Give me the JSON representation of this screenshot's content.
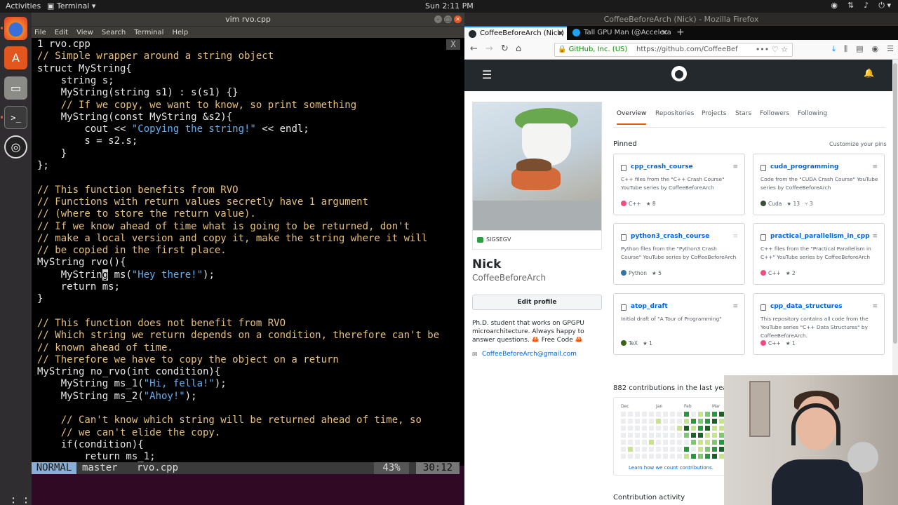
{
  "topbar": {
    "activities": "Activities",
    "app_name": "Terminal",
    "clock": "Sun  2:11 PM"
  },
  "dock": {
    "icons": [
      "firefox-icon",
      "software-icon",
      "files-icon",
      "terminal-icon",
      "obs-icon",
      "show-apps-icon"
    ]
  },
  "terminal": {
    "title": "vim rvo.cpp",
    "menu": [
      "File",
      "Edit",
      "View",
      "Search",
      "Terminal",
      "Help"
    ],
    "tab_close": "X",
    "lines": [
      {
        "ln": "1 ",
        "parts": [
          {
            "t": "rvo.cpp",
            "c": "c-def"
          }
        ]
      },
      {
        "parts": [
          {
            "t": "// Simple wrapper around a string object",
            "c": "c-com"
          }
        ]
      },
      {
        "parts": [
          {
            "t": "struct MyString{",
            "c": "c-def"
          }
        ]
      },
      {
        "parts": [
          {
            "t": "    string s;",
            "c": "c-def"
          }
        ]
      },
      {
        "parts": [
          {
            "t": "    MyString(string s1) : s(s1) {}",
            "c": "c-def"
          }
        ]
      },
      {
        "parts": [
          {
            "t": "    // If we copy, we want to know, so print something",
            "c": "c-com"
          }
        ]
      },
      {
        "parts": [
          {
            "t": "    MyString(const MyString &s2){",
            "c": "c-def"
          }
        ]
      },
      {
        "parts": [
          {
            "t": "        cout << ",
            "c": "c-def"
          },
          {
            "t": "\"Copying the string!\"",
            "c": "c-str"
          },
          {
            "t": " << endl;",
            "c": "c-def"
          }
        ]
      },
      {
        "parts": [
          {
            "t": "        s = s2.s;",
            "c": "c-def"
          }
        ]
      },
      {
        "parts": [
          {
            "t": "    }",
            "c": "c-def"
          }
        ]
      },
      {
        "parts": [
          {
            "t": "};",
            "c": "c-def"
          }
        ]
      },
      {
        "parts": [
          {
            "t": "",
            "c": "c-def"
          }
        ]
      },
      {
        "parts": [
          {
            "t": "// This function benefits from RVO",
            "c": "c-com"
          }
        ]
      },
      {
        "parts": [
          {
            "t": "// Functions with return values secretly have 1 argument",
            "c": "c-com"
          }
        ]
      },
      {
        "parts": [
          {
            "t": "// (where to store the return value).",
            "c": "c-com"
          }
        ]
      },
      {
        "parts": [
          {
            "t": "// If we know ahead of time what is going to be returned, don't",
            "c": "c-com"
          }
        ]
      },
      {
        "parts": [
          {
            "t": "// make a local version and copy it, make the string where it will",
            "c": "c-com"
          }
        ]
      },
      {
        "parts": [
          {
            "t": "// be copied in the first place.",
            "c": "c-com"
          }
        ]
      },
      {
        "parts": [
          {
            "t": "MyString rvo(){",
            "c": "c-def"
          }
        ]
      },
      {
        "parts": [
          {
            "t": "    MyStrin",
            "c": "c-def"
          },
          {
            "t": "g",
            "c": "cursor"
          },
          {
            "t": " ms(",
            "c": "c-def"
          },
          {
            "t": "\"Hey there!\"",
            "c": "c-str"
          },
          {
            "t": ");",
            "c": "c-def"
          }
        ]
      },
      {
        "parts": [
          {
            "t": "    return ms;",
            "c": "c-def"
          }
        ]
      },
      {
        "parts": [
          {
            "t": "}",
            "c": "c-def"
          }
        ]
      },
      {
        "parts": [
          {
            "t": "",
            "c": "c-def"
          }
        ]
      },
      {
        "parts": [
          {
            "t": "// This function does not benefit from RVO",
            "c": "c-com"
          }
        ]
      },
      {
        "parts": [
          {
            "t": "// Which string we return depends on a condition, therefore can't be",
            "c": "c-com"
          }
        ]
      },
      {
        "parts": [
          {
            "t": "// known ahead of time.",
            "c": "c-com"
          }
        ]
      },
      {
        "parts": [
          {
            "t": "// Therefore we have to copy the object on a return",
            "c": "c-com"
          }
        ]
      },
      {
        "parts": [
          {
            "t": "MyString no_rvo(int condition){",
            "c": "c-def"
          }
        ]
      },
      {
        "parts": [
          {
            "t": "    MyString ms_1(",
            "c": "c-def"
          },
          {
            "t": "\"Hi, fella!\"",
            "c": "c-str"
          },
          {
            "t": ");",
            "c": "c-def"
          }
        ]
      },
      {
        "parts": [
          {
            "t": "    MyString ms_2(",
            "c": "c-def"
          },
          {
            "t": "\"Ahoy!\"",
            "c": "c-str"
          },
          {
            "t": ");",
            "c": "c-def"
          }
        ]
      },
      {
        "parts": [
          {
            "t": "",
            "c": "c-def"
          }
        ]
      },
      {
        "parts": [
          {
            "t": "    // Can't know which string will be returned ahead of time, so",
            "c": "c-com"
          }
        ]
      },
      {
        "parts": [
          {
            "t": "    // we can't elide the copy.",
            "c": "c-com"
          }
        ]
      },
      {
        "parts": [
          {
            "t": "    if(condition){",
            "c": "c-def"
          }
        ]
      },
      {
        "parts": [
          {
            "t": "        return ms_1;",
            "c": "c-def"
          }
        ]
      }
    ],
    "status": {
      "mode": "NORMAL",
      "branch": "master",
      "file": "rvo.cpp",
      "percent": "43%",
      "position": "30:12"
    }
  },
  "firefox": {
    "title": "CoffeeBeforeArch (Nick) - Mozilla Firefox",
    "tabs": [
      {
        "label": "CoffeeBeforeArch (Nick)",
        "close": "✕"
      },
      {
        "label": "Tall GPU Man (@Accelera",
        "close": "✕"
      }
    ],
    "new_tab": "+",
    "url_security": "GitHub, Inc. (US)",
    "url": "https://github.com/CoffeeBef",
    "url_icons": "••• ♡ ☆"
  },
  "github": {
    "avatar_status": "SIGSEGV",
    "name": "Nick",
    "login": "CoffeeBeforeArch",
    "edit_profile": "Edit profile",
    "bio": "Ph.D. student that works on GPGPU microarchitecture. Always happy to answer questions. 🦀 Free Code 🦀",
    "email": "CoffeeBeforeArch@gmail.com",
    "tabs": [
      "Overview",
      "Repositories",
      "Projects",
      "Stars",
      "Followers",
      "Following"
    ],
    "pinned_label": "Pinned",
    "customize": "Customize your pins",
    "repos": [
      {
        "name": "cpp_crash_course",
        "desc": "C++ files from the \"C++ Crash Course\" YouTube series by CoffeeBeforeArch",
        "lang": "C++",
        "color": "#f34b7d",
        "stars": "8",
        "forks": ""
      },
      {
        "name": "cuda_programming",
        "desc": "Code from the \"CUDA Crash Course\" YouTube series by CoffeeBeforeArch",
        "lang": "Cuda",
        "color": "#3a4e3a",
        "stars": "13",
        "forks": "3"
      },
      {
        "name": "python3_crash_course",
        "desc": "Python files from the \"Python3 Crash Course\" YouTube series by CoffeeBeforeArch",
        "lang": "Python",
        "color": "#3572a5",
        "stars": "5",
        "forks": ""
      },
      {
        "name": "practical_parallelism_in_cpp",
        "desc": "C++ files from the \"Practical Parallelism in C++\" YouTube series by CoffeeBeforeArch",
        "lang": "C++",
        "color": "#f34b7d",
        "stars": "2",
        "forks": ""
      },
      {
        "name": "atop_draft",
        "desc": "Initial draft of \"A Tour of Programming\"",
        "lang": "TeX",
        "color": "#3d6117",
        "stars": "1",
        "forks": ""
      },
      {
        "name": "cpp_data_structures",
        "desc": "This repository contains all code from the YouTube series \"C++ Data Structures\" by CoffeeBeforeArch.",
        "lang": "C++",
        "color": "#f34b7d",
        "stars": "1",
        "forks": ""
      }
    ],
    "contributions": "882 contributions in the last year",
    "months": [
      "Dec",
      "Jan",
      "Feb",
      "Mar"
    ],
    "learn": "Learn how we count contributions.",
    "activity": "Contribution activity"
  }
}
